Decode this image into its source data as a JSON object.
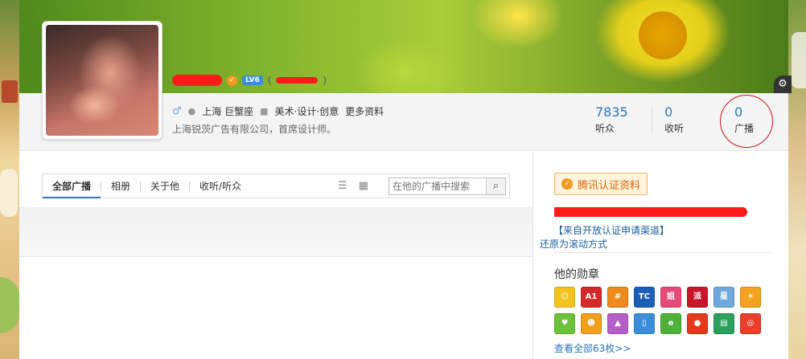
{
  "profile": {
    "gender_icon": "male-icon",
    "location": "上海 巨蟹座",
    "industry": "美术·设计·创意",
    "more_info": "更多资料",
    "bio": "上海锐茨广告有限公司，首席设计师。",
    "level": "LV6",
    "paren_open": "(",
    "paren_close": ")"
  },
  "stats": [
    {
      "num": "7835",
      "label": "听众"
    },
    {
      "num": "0",
      "label": "收听"
    },
    {
      "num": "0",
      "label": "广播"
    }
  ],
  "tabs": [
    {
      "label": "全部广播"
    },
    {
      "label": "相册"
    },
    {
      "label": "关于他"
    },
    {
      "label": "收听/听众"
    }
  ],
  "search": {
    "placeholder": "在他的广播中搜索"
  },
  "right": {
    "verify_label": "腾讯认证资料",
    "channel_link": "【来自开放认证申请渠道】",
    "scroll_link": "还原为滚动方式",
    "medals_title": "他的勋章",
    "view_all": "查看全部63枚>>"
  },
  "medals": [
    {
      "glyph": "☺",
      "color": "#f3c21e"
    },
    {
      "glyph": "A1",
      "color": "#d42a2a"
    },
    {
      "glyph": "#",
      "color": "#f08a1a"
    },
    {
      "glyph": "TC",
      "color": "#1c5fb8"
    },
    {
      "glyph": "姐",
      "color": "#e64a7a"
    },
    {
      "glyph": "派",
      "color": "#c8162a"
    },
    {
      "glyph": "星",
      "color": "#6fa8dc"
    },
    {
      "glyph": "☀",
      "color": "#f3a21e"
    },
    {
      "glyph": "♥",
      "color": "#6cc23a"
    },
    {
      "glyph": "☻",
      "color": "#f1a01e"
    },
    {
      "glyph": "▲",
      "color": "#b45fc7"
    },
    {
      "glyph": "▯",
      "color": "#3a8fd8"
    },
    {
      "glyph": "e",
      "color": "#4fb03a"
    },
    {
      "glyph": "●",
      "color": "#e23a1a"
    },
    {
      "glyph": "▤",
      "color": "#2aa05a"
    },
    {
      "glyph": "◎",
      "color": "#e8402a"
    }
  ]
}
